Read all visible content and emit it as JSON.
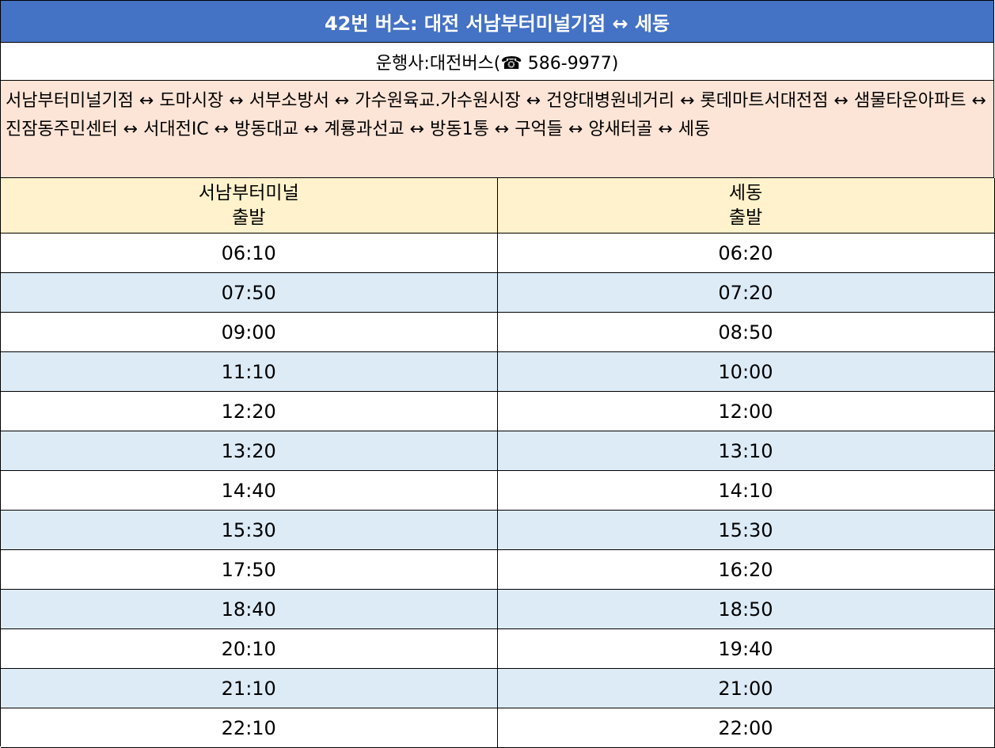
{
  "title": "42번 버스: 대전 서남부터미널기점 ↔ 세동",
  "operator": "운행사:대전버스(☎ 586-9977)",
  "route": "서남부터미널기점 ↔  도마시장 ↔ 서부소방서 ↔ 가수원육교.가수원시장 ↔ 건양대병원네거리 ↔ 롯데마트서대전점 ↔ 샘물타운아파트 ↔ 진잠동주민센터 ↔ 서대전IC ↔ 방동대교 ↔ 계룡과선교 ↔ 방동1통 ↔ 구억들 ↔ 양새터골 ↔ 세동",
  "columns": [
    {
      "line1": "서남부터미널",
      "line2": "출발"
    },
    {
      "line1": "세동",
      "line2": "출발"
    }
  ],
  "rows": [
    [
      "06:10",
      "06:20"
    ],
    [
      "07:50",
      "07:20"
    ],
    [
      "09:00",
      "08:50"
    ],
    [
      "11:10",
      "10:00"
    ],
    [
      "12:20",
      "12:00"
    ],
    [
      "13:20",
      "13:10"
    ],
    [
      "14:40",
      "14:10"
    ],
    [
      "15:30",
      "15:30"
    ],
    [
      "17:50",
      "16:20"
    ],
    [
      "18:40",
      "18:50"
    ],
    [
      "20:10",
      "19:40"
    ],
    [
      "21:10",
      "21:00"
    ],
    [
      "22:10",
      "22:00"
    ]
  ],
  "colors": {
    "title_bg": "#4472c4",
    "route_bg": "#fce4d6",
    "header_bg": "#fff2cc",
    "alt_row_bg": "#ddebf7"
  }
}
